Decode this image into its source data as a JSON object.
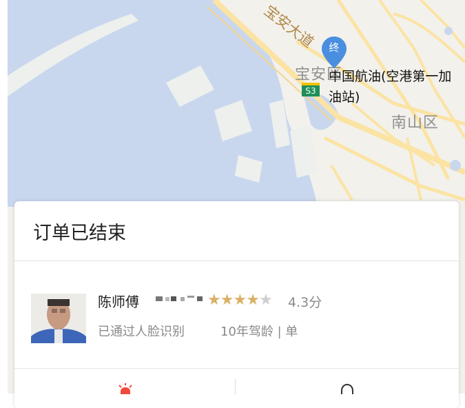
{
  "map": {
    "end_pin_label": "终",
    "road_label": "宝安大道",
    "district_baoan": "宝安区",
    "district_nanshan": "南山区",
    "poi_line1": "中国航油(空港第一加",
    "poi_line2": "油站)",
    "road_badge": "S3",
    "colors": {
      "water": "#c9d7ee",
      "land": "#f3f1ec",
      "road": "#fbe3a3",
      "pin": "#4a8ee0"
    }
  },
  "order": {
    "status_title": "订单已结束"
  },
  "driver": {
    "name": "陈师傅",
    "rating_stars": 4.3,
    "rating_text": "4.3分",
    "face_verified": "已通过人脸识别",
    "experience": "10年驾龄 | 单"
  },
  "bottom_actions": [
    {
      "icon": "alarm-icon",
      "color": "#f04a3e"
    },
    {
      "icon": "headset-icon",
      "color": "#333333"
    }
  ]
}
